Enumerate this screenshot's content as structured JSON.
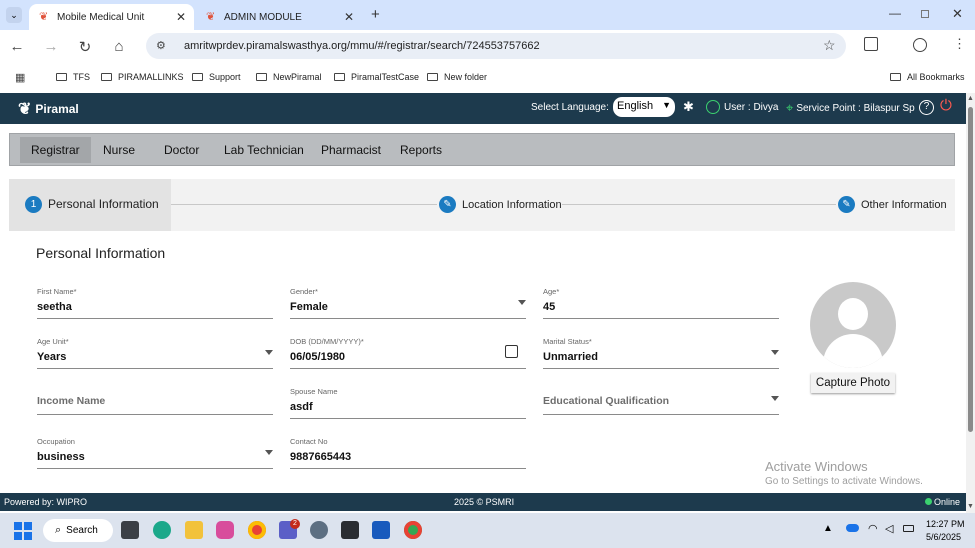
{
  "browser": {
    "tabs": [
      {
        "title": "Mobile Medical Unit",
        "active": true
      },
      {
        "title": "ADMIN MODULE",
        "active": false
      }
    ],
    "url": "amritwprdev.piramalswasthya.org/mmu/#/registrar/search/724553757662",
    "bookmarks": [
      "TFS",
      "PIRAMALLINKS",
      "Support",
      "NewPiramal",
      "PiramalTestCase",
      "New folder"
    ],
    "all_bookmarks": "All Bookmarks"
  },
  "header": {
    "brand": "Piramal",
    "select_language_label": "Select Language:",
    "language": "English",
    "user": "User : Divya",
    "service_point": "Service Point : Bilaspur Sp"
  },
  "nav": [
    "Registrar",
    "Nurse",
    "Doctor",
    "Lab Technician",
    "Pharmacist",
    "Reports"
  ],
  "stepper": {
    "step1_number": "1",
    "step1": "Personal Information",
    "step2": "Location Information",
    "step3": "Other Information"
  },
  "form": {
    "title": "Personal Information",
    "first_name": {
      "label": "First Name*",
      "value": "seetha"
    },
    "gender": {
      "label": "Gender*",
      "value": "Female"
    },
    "age": {
      "label": "Age*",
      "value": "45"
    },
    "age_unit": {
      "label": "Age Unit*",
      "value": "Years"
    },
    "dob": {
      "label": "DOB (DD/MM/YYYY)*",
      "value": "06/05/1980"
    },
    "marital_status": {
      "label": "Marital Status*",
      "value": "Unmarried"
    },
    "income_name": {
      "placeholder": "Income Name"
    },
    "spouse_name": {
      "label": "Spouse Name",
      "value": "asdf"
    },
    "educational_qualification": {
      "placeholder": "Educational Qualification"
    },
    "occupation": {
      "label": "Occupation",
      "value": "business"
    },
    "contact_no": {
      "label": "Contact No",
      "value": "9887665443"
    },
    "capture_photo": "Capture Photo"
  },
  "watermark": {
    "line1": "Activate Windows",
    "line2": "Go to Settings to activate Windows."
  },
  "footer": {
    "left": "Powered by: WIPRO",
    "center": "2025 © PSMRI",
    "status": "Online"
  },
  "taskbar": {
    "search": "Search",
    "time": "12:27 PM",
    "date": "5/6/2025",
    "teams_badge": "2"
  },
  "colors": {
    "header_bg": "#1d3a4d",
    "accent": "#1b7bc1",
    "online": "#3bd16f"
  }
}
